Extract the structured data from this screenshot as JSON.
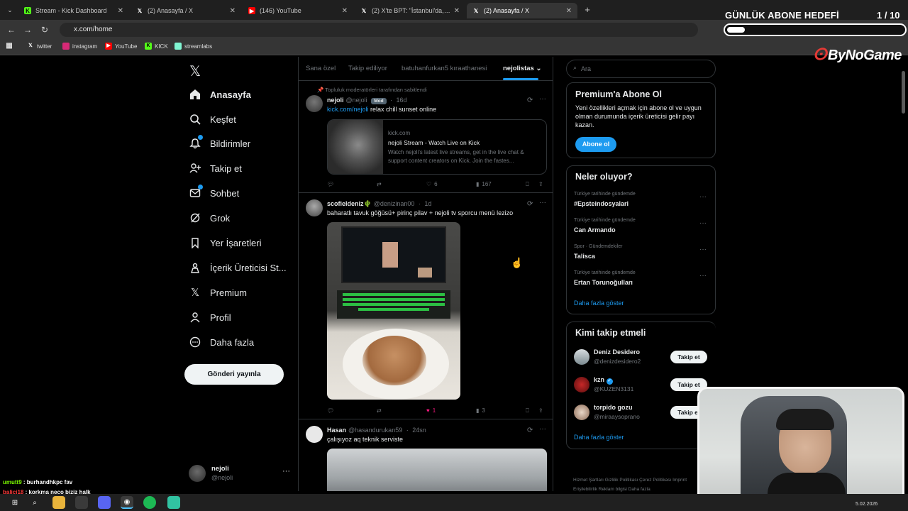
{
  "browser": {
    "tabs": [
      {
        "title": "Stream - Kick Dashboard",
        "icon": "kick-icon",
        "color": "#53fc18"
      },
      {
        "title": "(2) Anasayfa / X",
        "icon": "x-icon",
        "color": "#ffffff"
      },
      {
        "title": "(146) YouTube",
        "icon": "youtube-icon",
        "color": "#ff0000"
      },
      {
        "title": "(2) X'te BPT: \"İstanbul'da, madde...",
        "icon": "x-icon",
        "color": "#ffffff"
      },
      {
        "title": "(2) Anasayfa / X",
        "icon": "x-icon",
        "color": "#ffffff"
      }
    ],
    "url": "x.com/home",
    "bookmarks": [
      "twitter",
      "instagram",
      "YouTube",
      "KICK",
      "streamlabs"
    ]
  },
  "overlay": {
    "goal_label": "GÜNLÜK ABONE HEDEFİ",
    "goal_count": "1 / 10",
    "goal_progress": 0.1,
    "brand": "ByNoGame"
  },
  "nav": {
    "items": [
      {
        "label": "Anasayfa",
        "icon": "home-icon",
        "bold": true
      },
      {
        "label": "Keşfet",
        "icon": "search-icon"
      },
      {
        "label": "Bildirimler",
        "icon": "bell-icon"
      },
      {
        "label": "Takip et",
        "icon": "add-user-icon"
      },
      {
        "label": "Sohbet",
        "icon": "mail-icon"
      },
      {
        "label": "Grok",
        "icon": "grok-icon"
      },
      {
        "label": "Yer İşaretleri",
        "icon": "bookmark-icon"
      },
      {
        "label": "İçerik Üreticisi St...",
        "icon": "creator-icon"
      },
      {
        "label": "Premium",
        "icon": "x-icon"
      },
      {
        "label": "Profil",
        "icon": "profile-icon"
      },
      {
        "label": "Daha fazla",
        "icon": "more-icon"
      }
    ],
    "post_button": "Gönderi yayınla",
    "account_name": "nejoli",
    "account_handle": "@nejoli"
  },
  "feed": {
    "tabs": [
      "Sana özel",
      "Takip ediliyor",
      "batuhanfurkan5 kıraathanesi",
      "nejolistas"
    ],
    "active_tab": "nejolistas",
    "tweets": [
      {
        "pinned_label": "Topluluk moderatörleri tarafından sabitlendi",
        "name": "nejoli",
        "handle": "@nejoli",
        "badge": "Mod",
        "time": "16d",
        "link": "kick.com/nejoli",
        "text": "relax chill sunset online",
        "card_domain": "kick.com",
        "card_title": "nejoli Stream - Watch Live on Kick",
        "card_desc": "Watch nejoli's latest live streams, get in the live chat & support content creators on Kick. Join the fastes...",
        "likes": "6",
        "views": "167"
      },
      {
        "name": "scofieldeniz🌵",
        "handle": "@denizinan00",
        "time": "1d",
        "text": "baharatlı tavuk göğüsü+ pirinç pilav + nejoli tv sporcu menü lezizo",
        "likes": "1",
        "views": "3"
      },
      {
        "name": "Hasan",
        "handle": "@hasandurukan59",
        "time": "24sn",
        "text": "çalışıyoz aq teknik serviste"
      }
    ]
  },
  "right": {
    "search_placeholder": "Ara",
    "premium": {
      "title": "Premium'a Abone Ol",
      "desc": "Yeni özellikleri açmak için abone ol ve uygun olman durumunda içerik üreticisi gelir payı kazan.",
      "button": "Abone ol"
    },
    "trends": {
      "title": "Neler oluyor?",
      "items": [
        {
          "category": "Türkiye tarihinde gündemde",
          "name": "#Epsteindosyalari"
        },
        {
          "category": "Türkiye tarihinde gündemde",
          "name": "Can Armando"
        },
        {
          "category": "Spor · Gündemdekiler",
          "name": "Talisca"
        },
        {
          "category": "Türkiye tarihinde gündemde",
          "name": "Ertan Torunoğulları"
        }
      ],
      "show_more": "Daha fazla göster"
    },
    "who_to_follow": {
      "title": "Kimi takip etmeli",
      "items": [
        {
          "name": "Deniz Desidero",
          "handle": "@denizdesidero2",
          "verified": false
        },
        {
          "name": "kzn",
          "handle": "@KUZEN3131",
          "verified": true
        },
        {
          "name": "torpido gozu",
          "handle": "@miraaysoprano",
          "verified": false
        }
      ],
      "follow_label": "Takip et",
      "show_more": "Daha fazla göster"
    },
    "footer": "Hizmet Şartları   Gizlilik Politikası   Çerez Politikası   Imprint   Erişilebilirlik   Reklam bilgisi   Daha fazla"
  },
  "chat": [
    {
      "user": "umutt9",
      "msg": "burhandhkpc fav",
      "color": "#7cfc00"
    },
    {
      "user": "balici18",
      "msg": "korkma neco biziz halk",
      "color": "#ff3b3b"
    }
  ],
  "taskbar": {
    "date": "5.02.2026"
  }
}
